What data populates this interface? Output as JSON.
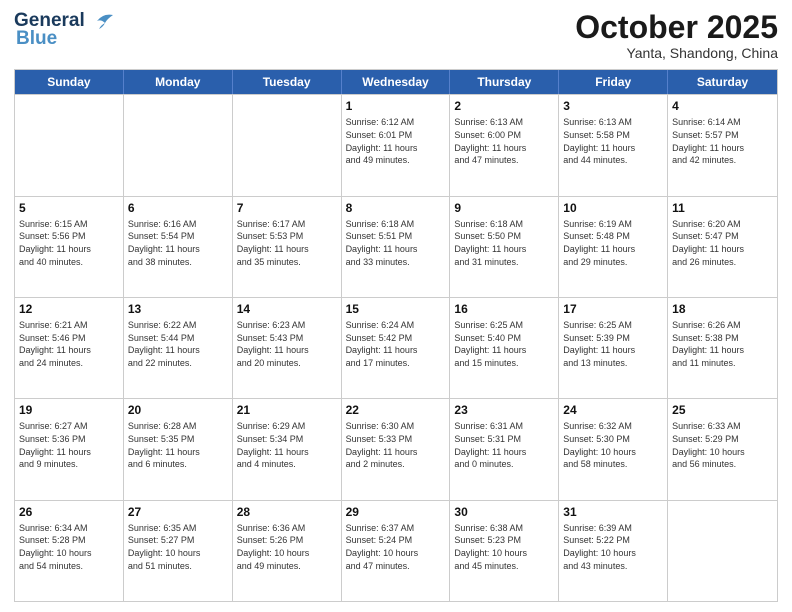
{
  "header": {
    "logo_general": "General",
    "logo_blue": "Blue",
    "month": "October 2025",
    "location": "Yanta, Shandong, China"
  },
  "days_of_week": [
    "Sunday",
    "Monday",
    "Tuesday",
    "Wednesday",
    "Thursday",
    "Friday",
    "Saturday"
  ],
  "weeks": [
    [
      {
        "day": "",
        "info": ""
      },
      {
        "day": "",
        "info": ""
      },
      {
        "day": "",
        "info": ""
      },
      {
        "day": "1",
        "info": "Sunrise: 6:12 AM\nSunset: 6:01 PM\nDaylight: 11 hours\nand 49 minutes."
      },
      {
        "day": "2",
        "info": "Sunrise: 6:13 AM\nSunset: 6:00 PM\nDaylight: 11 hours\nand 47 minutes."
      },
      {
        "day": "3",
        "info": "Sunrise: 6:13 AM\nSunset: 5:58 PM\nDaylight: 11 hours\nand 44 minutes."
      },
      {
        "day": "4",
        "info": "Sunrise: 6:14 AM\nSunset: 5:57 PM\nDaylight: 11 hours\nand 42 minutes."
      }
    ],
    [
      {
        "day": "5",
        "info": "Sunrise: 6:15 AM\nSunset: 5:56 PM\nDaylight: 11 hours\nand 40 minutes."
      },
      {
        "day": "6",
        "info": "Sunrise: 6:16 AM\nSunset: 5:54 PM\nDaylight: 11 hours\nand 38 minutes."
      },
      {
        "day": "7",
        "info": "Sunrise: 6:17 AM\nSunset: 5:53 PM\nDaylight: 11 hours\nand 35 minutes."
      },
      {
        "day": "8",
        "info": "Sunrise: 6:18 AM\nSunset: 5:51 PM\nDaylight: 11 hours\nand 33 minutes."
      },
      {
        "day": "9",
        "info": "Sunrise: 6:18 AM\nSunset: 5:50 PM\nDaylight: 11 hours\nand 31 minutes."
      },
      {
        "day": "10",
        "info": "Sunrise: 6:19 AM\nSunset: 5:48 PM\nDaylight: 11 hours\nand 29 minutes."
      },
      {
        "day": "11",
        "info": "Sunrise: 6:20 AM\nSunset: 5:47 PM\nDaylight: 11 hours\nand 26 minutes."
      }
    ],
    [
      {
        "day": "12",
        "info": "Sunrise: 6:21 AM\nSunset: 5:46 PM\nDaylight: 11 hours\nand 24 minutes."
      },
      {
        "day": "13",
        "info": "Sunrise: 6:22 AM\nSunset: 5:44 PM\nDaylight: 11 hours\nand 22 minutes."
      },
      {
        "day": "14",
        "info": "Sunrise: 6:23 AM\nSunset: 5:43 PM\nDaylight: 11 hours\nand 20 minutes."
      },
      {
        "day": "15",
        "info": "Sunrise: 6:24 AM\nSunset: 5:42 PM\nDaylight: 11 hours\nand 17 minutes."
      },
      {
        "day": "16",
        "info": "Sunrise: 6:25 AM\nSunset: 5:40 PM\nDaylight: 11 hours\nand 15 minutes."
      },
      {
        "day": "17",
        "info": "Sunrise: 6:25 AM\nSunset: 5:39 PM\nDaylight: 11 hours\nand 13 minutes."
      },
      {
        "day": "18",
        "info": "Sunrise: 6:26 AM\nSunset: 5:38 PM\nDaylight: 11 hours\nand 11 minutes."
      }
    ],
    [
      {
        "day": "19",
        "info": "Sunrise: 6:27 AM\nSunset: 5:36 PM\nDaylight: 11 hours\nand 9 minutes."
      },
      {
        "day": "20",
        "info": "Sunrise: 6:28 AM\nSunset: 5:35 PM\nDaylight: 11 hours\nand 6 minutes."
      },
      {
        "day": "21",
        "info": "Sunrise: 6:29 AM\nSunset: 5:34 PM\nDaylight: 11 hours\nand 4 minutes."
      },
      {
        "day": "22",
        "info": "Sunrise: 6:30 AM\nSunset: 5:33 PM\nDaylight: 11 hours\nand 2 minutes."
      },
      {
        "day": "23",
        "info": "Sunrise: 6:31 AM\nSunset: 5:31 PM\nDaylight: 11 hours\nand 0 minutes."
      },
      {
        "day": "24",
        "info": "Sunrise: 6:32 AM\nSunset: 5:30 PM\nDaylight: 10 hours\nand 58 minutes."
      },
      {
        "day": "25",
        "info": "Sunrise: 6:33 AM\nSunset: 5:29 PM\nDaylight: 10 hours\nand 56 minutes."
      }
    ],
    [
      {
        "day": "26",
        "info": "Sunrise: 6:34 AM\nSunset: 5:28 PM\nDaylight: 10 hours\nand 54 minutes."
      },
      {
        "day": "27",
        "info": "Sunrise: 6:35 AM\nSunset: 5:27 PM\nDaylight: 10 hours\nand 51 minutes."
      },
      {
        "day": "28",
        "info": "Sunrise: 6:36 AM\nSunset: 5:26 PM\nDaylight: 10 hours\nand 49 minutes."
      },
      {
        "day": "29",
        "info": "Sunrise: 6:37 AM\nSunset: 5:24 PM\nDaylight: 10 hours\nand 47 minutes."
      },
      {
        "day": "30",
        "info": "Sunrise: 6:38 AM\nSunset: 5:23 PM\nDaylight: 10 hours\nand 45 minutes."
      },
      {
        "day": "31",
        "info": "Sunrise: 6:39 AM\nSunset: 5:22 PM\nDaylight: 10 hours\nand 43 minutes."
      },
      {
        "day": "",
        "info": ""
      }
    ]
  ]
}
